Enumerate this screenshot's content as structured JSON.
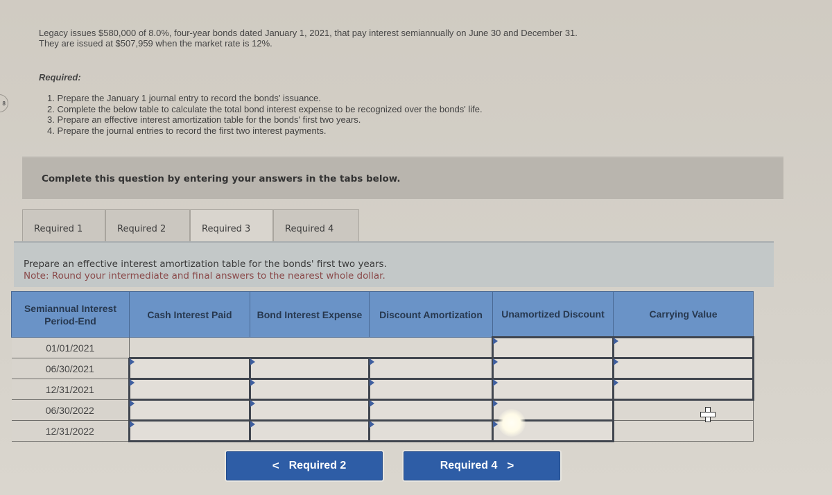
{
  "problem": {
    "intro_line1": "Legacy issues $580,000 of 8.0%, four-year bonds dated January 1, 2021, that pay interest semiannually on June 30 and December 31.",
    "intro_line2": "They are issued at $507,959 when the market rate is 12%.",
    "required_label": "Required:",
    "requirements": [
      "1. Prepare the January 1 journal entry to record the bonds' issuance.",
      "2. Complete the below table to calculate the total bond interest expense to be recognized over the bonds' life.",
      "3. Prepare an effective interest amortization table for the bonds' first two years.",
      "4. Prepare the journal entries to record the first two interest payments."
    ]
  },
  "instruction": "Complete this question by entering your answers in the tabs below.",
  "tabs": [
    {
      "label": "Required 1",
      "active": false
    },
    {
      "label": "Required 2",
      "active": false
    },
    {
      "label": "Required 3",
      "active": true
    },
    {
      "label": "Required 4",
      "active": false
    }
  ],
  "prompt": {
    "line1": "Prepare an effective interest amortization table for the bonds' first two years.",
    "note": "Note: Round your intermediate and final answers to the nearest whole dollar."
  },
  "table": {
    "headers": [
      "Semiannual Interest Period-End",
      "Cash Interest Paid",
      "Bond Interest Expense",
      "Discount Amortization",
      "Unamortized Discount",
      "Carrying Value"
    ],
    "rows": [
      {
        "date": "01/01/2021",
        "cash": "",
        "expense": "",
        "amortization": "",
        "unamortized": "",
        "carrying": ""
      },
      {
        "date": "06/30/2021",
        "cash": "",
        "expense": "",
        "amortization": "",
        "unamortized": "",
        "carrying": ""
      },
      {
        "date": "12/31/2021",
        "cash": "",
        "expense": "",
        "amortization": "",
        "unamortized": "",
        "carrying": ""
      },
      {
        "date": "06/30/2022",
        "cash": "",
        "expense": "",
        "amortization": "",
        "unamortized": "",
        "carrying": ""
      },
      {
        "date": "12/31/2022",
        "cash": "",
        "expense": "",
        "amortization": "",
        "unamortized": "",
        "carrying": ""
      }
    ]
  },
  "navigation": {
    "prev_label": "Required 2",
    "next_label": "Required 4",
    "prev_icon": "chevron-left-icon",
    "next_icon": "chevron-right-icon"
  },
  "colors": {
    "header_blue": "#6a93c7",
    "button_blue": "#2e5da6",
    "note_red": "#8a4a4a"
  }
}
